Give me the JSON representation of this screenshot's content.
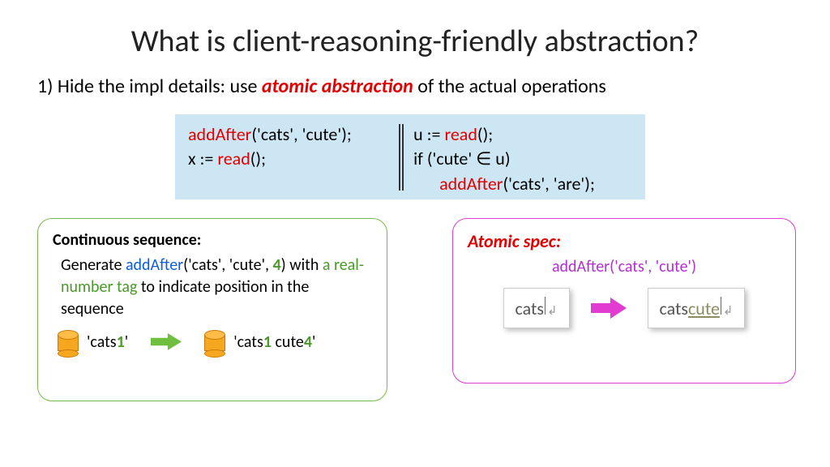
{
  "title": "What is client-reasoning-friendly abstraction?",
  "point1": {
    "prefix": "1) Hide the impl details: use ",
    "emph": "atomic abstraction",
    "suffix": " of the actual operations"
  },
  "code": {
    "left": {
      "l1_fn": "addAfter",
      "l1_args": "('cats', 'cute');",
      "l2_pre": "x := ",
      "l2_fn": "read",
      "l2_post": "();"
    },
    "right": {
      "l1_pre": "u := ",
      "l1_fn": "read",
      "l1_post": "();",
      "l2": "if ('cute' ∈ u)",
      "l3_fn": "addAfter",
      "l3_args": "('cats', 'are');"
    }
  },
  "left_panel": {
    "title": "Continuous sequence:",
    "desc_pre": "Generate ",
    "desc_call_fn": "addAfter",
    "desc_call_open": "(",
    "desc_call_a1": "'cats', 'cute', ",
    "desc_call_tag": "4",
    "desc_call_close": ")",
    "desc_mid": " with ",
    "desc_green": "a real-number tag",
    "desc_tail": " to indicate position in the sequence",
    "cyl1_pre": "'cats",
    "cyl1_tag": "1",
    "cyl1_post": "'",
    "cyl2_pre": "'cats",
    "cyl2_tag": "1",
    "cyl2_mid": " cute",
    "cyl2_tag2": "4",
    "cyl2_post": "'"
  },
  "right_panel": {
    "title": "Atomic spec:",
    "call": "addAfter('cats', 'cute')",
    "snap1": "cats",
    "snap2_a": "cats ",
    "snap2_b": "cute",
    "return_glyph": "↲"
  }
}
